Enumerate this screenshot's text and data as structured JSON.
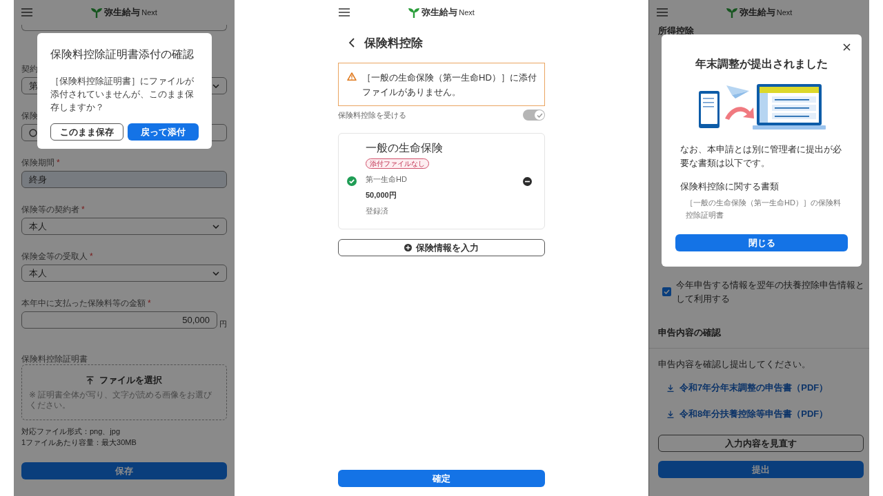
{
  "attachment_confirm_screen": {
    "header": {
      "logo_main": "弥生給与",
      "logo_sub": "Next"
    },
    "form": {
      "fields": [
        {
          "kind": "select",
          "label": "契約",
          "value": "第"
        },
        {
          "kind": "search",
          "label": "保険"
        },
        {
          "kind": "filled",
          "label": "保険期間",
          "required_mark": "*",
          "value": "終身"
        },
        {
          "kind": "select",
          "label": "保険等の契約者",
          "required_mark": "*",
          "value": "本人"
        },
        {
          "kind": "select",
          "label": "保険金等の受取人",
          "required_mark": "*",
          "value": "本人"
        },
        {
          "kind": "amount",
          "label": "本年中に支払った保険料等の金額",
          "required_mark": "*",
          "value": "50,000",
          "unit": "円"
        }
      ],
      "upload": {
        "label": "保険料控除証明書",
        "button": "ファイルを選択",
        "note": "※ 証明書全体が写り、文字が読める画像をお選びください。"
      },
      "file_info": [
        "対応ファイル形式：png、jpg",
        "1ファイルあたり容量：最大30MB"
      ],
      "save_button": "保存"
    },
    "dialog": {
      "title": "保険料控除証明書添付の確認",
      "message": "［保険料控除証明書］にファイルが添付されていませんが、このまま保存しますか？",
      "buttons": [
        {
          "kind": "secondary",
          "label": "このまま保存"
        },
        {
          "kind": "primary",
          "label": "戻って添付"
        }
      ]
    }
  },
  "insurance_deduction_screen": {
    "header": {
      "logo_main": "弥生給与",
      "logo_sub": "Next"
    },
    "page_title": "保険料控除",
    "warning": "［一般の生命保険（第一生命HD）］に添付ファイルがありません。",
    "toggle": {
      "label": "保険料控除を受ける",
      "on": true,
      "disabled": true
    },
    "policies": [
      {
        "title": "一般の生命保険",
        "badge": "添付ファイルなし",
        "complete": true,
        "company": "第一生命HD",
        "amount": "50,000円",
        "status": "登録済"
      }
    ],
    "add_button": "保険情報を入力",
    "confirm_button": "確定"
  },
  "submission_done_screen": {
    "header": {
      "logo_main": "弥生給与",
      "logo_sub": "Next"
    },
    "section_title": "所得控除",
    "next_year_checkbox": {
      "label": "今年申告する情報を翌年の扶養控除申告情報として利用する",
      "checked": true
    },
    "review": {
      "title": "申告内容の確認",
      "instruction": "申告内容を確認し提出してください。",
      "downloads": [
        "令和7年分年末調整の申告書（PDF）",
        "令和8年分扶養控除等申告書（PDF）"
      ],
      "review_button": "入力内容を見直す",
      "submit_button": "提出"
    },
    "dialog": {
      "title": "年末調整が提出されました",
      "message": "なお、本申請とは別に管理者に提出が必要な書類は以下です。",
      "documents_heading": "保険料控除に関する書類",
      "documents": [
        "［一般の生命保険（第一生命HD）］の保険料控除証明書"
      ],
      "close_button": "閉じる"
    }
  }
}
